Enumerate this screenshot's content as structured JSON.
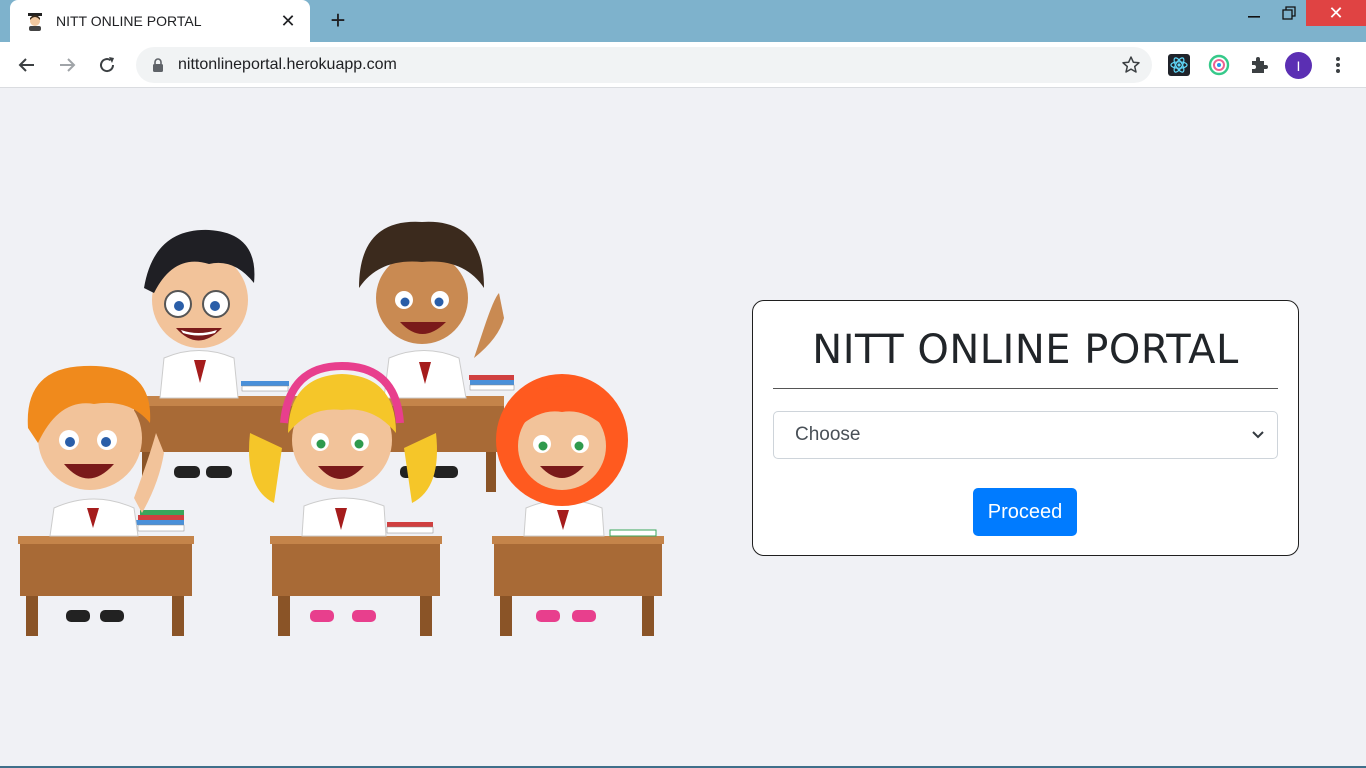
{
  "browser": {
    "tab_title": "NITT ONLINE PORTAL",
    "tab_close": "✕",
    "new_tab": "+",
    "url": "nittonlineportal.herokuapp.com",
    "avatar_initial": "I",
    "win_close": "✕"
  },
  "portal": {
    "title": "NITT ONLINE PORTAL",
    "select_value": "Choose",
    "button_label": "Proceed"
  },
  "colors": {
    "titlebar": "#7eb2cc",
    "page_bg": "#f0f1f5",
    "button": "#007bff",
    "avatar": "#5b2fb3"
  },
  "icons": [
    "student-favicon-icon",
    "back-arrow-icon",
    "forward-arrow-icon",
    "reload-icon",
    "lock-icon",
    "star-icon",
    "react-devtools-icon",
    "extension-ring-icon",
    "puzzle-icon",
    "menu-dots-icon",
    "chevron-down-icon"
  ]
}
